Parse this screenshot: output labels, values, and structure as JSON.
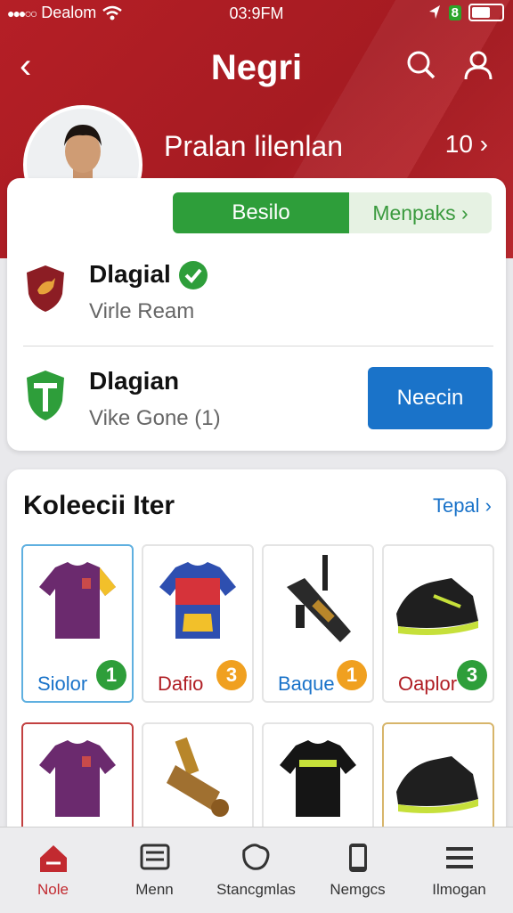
{
  "status_bar": {
    "carrier": "Dealom",
    "time": "03:9FM",
    "battery_label": "8"
  },
  "nav": {
    "title": "Negri"
  },
  "profile": {
    "name": "Pralan lilenlan",
    "count": "10 ›"
  },
  "toggle": {
    "active": "Besilo",
    "inactive": "Menpaks ›"
  },
  "teams": [
    {
      "name": "Dlagial",
      "sub": "Virle Ream",
      "verified": true
    },
    {
      "name": "Dlagian",
      "sub": "Vike Gone (1)",
      "button": "Neecin"
    }
  ],
  "collection": {
    "title": "Koleecii Iter",
    "link": "Tepal ›",
    "items": [
      {
        "label": "Siolor",
        "count": "1",
        "label_color": "#1a73c9",
        "count_color": "#2e9e3a",
        "icon": "jersey-icon"
      },
      {
        "label": "Dafio",
        "count": "3",
        "label_color": "#b01e24",
        "count_color": "#f0a020",
        "icon": "jersey-icon"
      },
      {
        "label": "Baque",
        "count": "1",
        "label_color": "#1a73c9",
        "count_color": "#f0a020",
        "icon": "rifle-icon"
      },
      {
        "label": "Oaplor",
        "count": "3",
        "label_color": "#b01e24",
        "count_color": "#2e9e3a",
        "icon": "shoe-icon"
      },
      {
        "label": "",
        "count": "",
        "icon": "jersey-icon"
      },
      {
        "label": "",
        "count": "",
        "icon": "cannon-icon"
      },
      {
        "label": "",
        "count": "",
        "icon": "shirt-icon"
      },
      {
        "label": "",
        "count": "",
        "icon": "shoe-icon"
      }
    ]
  },
  "tabs": [
    {
      "label": "Nole",
      "icon": "home-icon",
      "active": true
    },
    {
      "label": "Menn",
      "icon": "menu-list-icon"
    },
    {
      "label": "Stancgmlas",
      "icon": "map-icon"
    },
    {
      "label": "Nemgcs",
      "icon": "phone-icon"
    },
    {
      "label": "Ilmogan",
      "icon": "hamburger-icon"
    }
  ],
  "colors": {
    "brand_red": "#b51f26",
    "green": "#2e9e3a",
    "blue": "#1a73c9"
  }
}
